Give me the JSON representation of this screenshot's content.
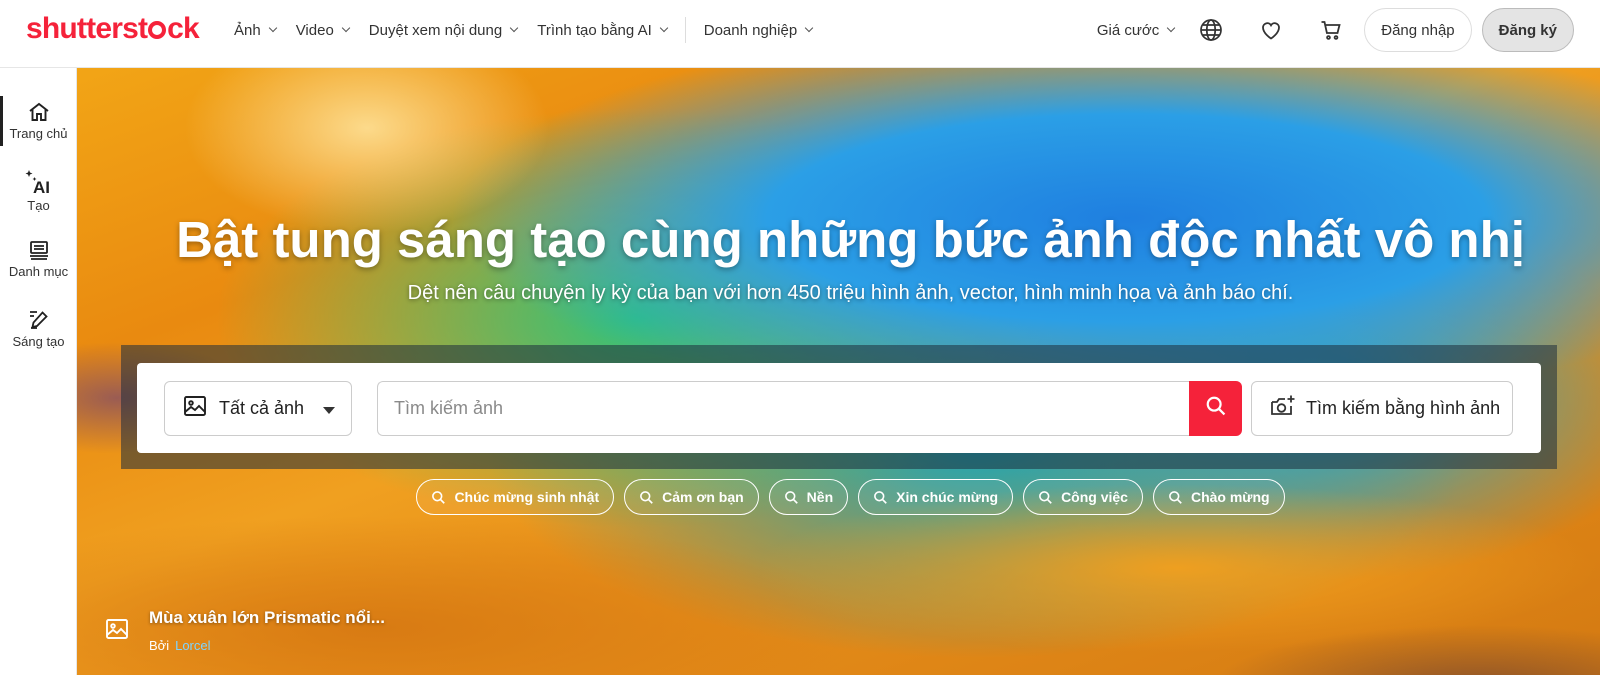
{
  "brand": {
    "logo_text_a": "shutterst",
    "logo_text_b": "ck",
    "color": "#f5223a"
  },
  "nav": {
    "items": [
      {
        "label": "Ảnh"
      },
      {
        "label": "Video"
      },
      {
        "label": "Duyệt xem nội dung"
      },
      {
        "label": "Trình tạo bằng AI"
      },
      {
        "label": "Doanh nghiệp"
      }
    ],
    "pricing": "Giá cước",
    "login": "Đăng nhập",
    "signup": "Đăng ký",
    "icons": [
      "globe-icon",
      "heart-icon",
      "cart-icon"
    ]
  },
  "sidebar": {
    "items": [
      {
        "label": "Trang chủ",
        "icon": "home-icon",
        "active": true
      },
      {
        "label": "Tạo",
        "icon": "ai-sparkle-icon"
      },
      {
        "label": "Danh mục",
        "icon": "catalog-icon"
      },
      {
        "label": "Sáng tạo",
        "icon": "edit-icon"
      }
    ]
  },
  "hero": {
    "title": "Bật tung sáng tạo cùng những bức ảnh độc nhất vô nhị",
    "subtitle": "Dệt nên câu chuyện ly kỳ của bạn với hơn 450 triệu hình ảnh, vector, hình minh họa và ảnh báo chí."
  },
  "search": {
    "type_label": "Tất cả ảnh",
    "placeholder": "Tìm kiếm ảnh",
    "image_search_label": "Tìm kiếm bằng hình ảnh"
  },
  "chips": [
    "Chúc mừng sinh nhật",
    "Cảm ơn bạn",
    "Nền",
    "Xin chúc mừng",
    "Công việc",
    "Chào mừng"
  ],
  "credit": {
    "title": "Mùa xuân lớn Prismatic nổi...",
    "by": "Bởi",
    "author": "Lorcel"
  }
}
